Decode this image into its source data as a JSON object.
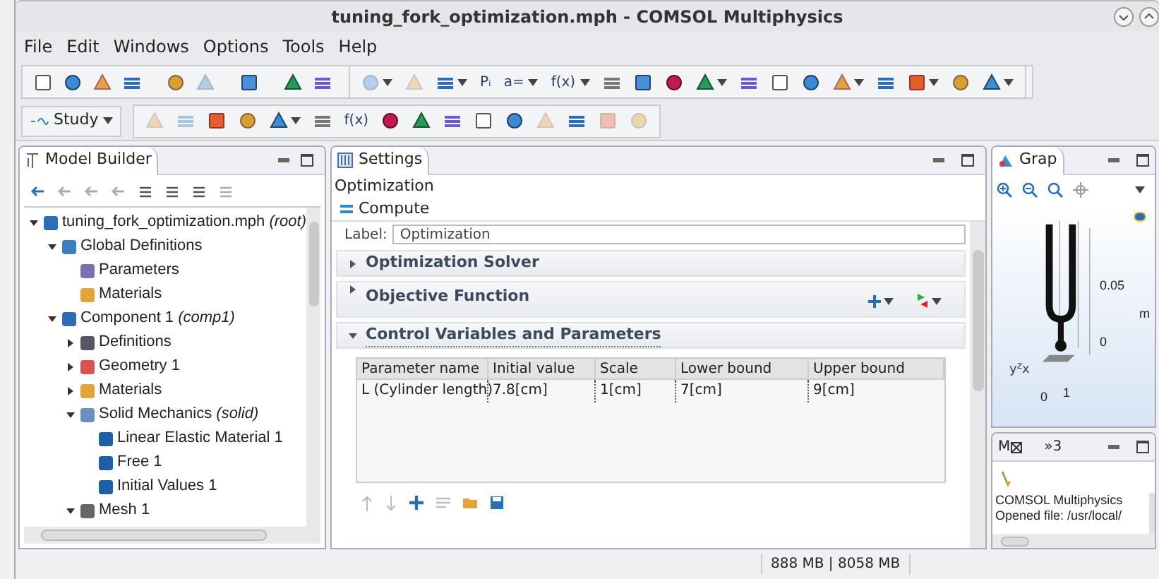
{
  "window": {
    "title": "tuning_fork_optimization.mph - COMSOL Multiphysics"
  },
  "menu": [
    "File",
    "Edit",
    "Windows",
    "Options",
    "Tools",
    "Help"
  ],
  "toolbar_1": [
    {
      "kind": "icon"
    },
    {
      "kind": "icon"
    },
    {
      "kind": "icon"
    },
    {
      "kind": "icon"
    },
    {
      "kind": "sep"
    },
    {
      "kind": "icon"
    },
    {
      "kind": "icon",
      "disabled": true
    },
    {
      "kind": "sep"
    },
    {
      "kind": "icon"
    },
    {
      "kind": "sep"
    },
    {
      "kind": "icon"
    },
    {
      "kind": "icon"
    },
    {
      "kind": "group"
    },
    {
      "kind": "icon",
      "disabled": true,
      "dropdown": true
    },
    {
      "kind": "icon",
      "disabled": true
    },
    {
      "kind": "icon",
      "dropdown": true
    },
    {
      "kind": "text",
      "label": "Pᵢ"
    },
    {
      "kind": "text",
      "label": "a=",
      "dropdown": true
    },
    {
      "kind": "text",
      "label": "f(x)",
      "dropdown": true
    },
    {
      "kind": "icon"
    },
    {
      "kind": "icon"
    },
    {
      "kind": "icon"
    },
    {
      "kind": "icon",
      "dropdown": true
    },
    {
      "kind": "icon"
    },
    {
      "kind": "icon"
    },
    {
      "kind": "icon"
    },
    {
      "kind": "icon",
      "dropdown": true
    },
    {
      "kind": "icon"
    },
    {
      "kind": "icon",
      "dropdown": true
    },
    {
      "kind": "icon"
    },
    {
      "kind": "icon",
      "dropdown": true
    }
  ],
  "toolbar_2": [
    {
      "kind": "study",
      "label": "Study",
      "dropdown": true
    },
    {
      "kind": "group"
    },
    {
      "kind": "icon",
      "disabled": true
    },
    {
      "kind": "icon",
      "disabled": true
    },
    {
      "kind": "icon"
    },
    {
      "kind": "icon"
    },
    {
      "kind": "icon",
      "dropdown": true
    },
    {
      "kind": "icon"
    },
    {
      "kind": "text",
      "label": "f(x)"
    },
    {
      "kind": "icon"
    },
    {
      "kind": "icon"
    },
    {
      "kind": "icon"
    },
    {
      "kind": "icon"
    },
    {
      "kind": "icon"
    },
    {
      "kind": "icon",
      "disabled": true
    },
    {
      "kind": "icon"
    },
    {
      "kind": "icon",
      "disabled": true
    },
    {
      "kind": "icon",
      "disabled": true
    }
  ],
  "model_builder": {
    "title": "Model Builder",
    "tree": [
      {
        "label": "tuning_fork_optimization.mph *(root)*",
        "expanded": true,
        "children": [
          {
            "label": "Global Definitions",
            "expanded": true,
            "children": [
              {
                "label": "Parameters"
              },
              {
                "label": "Materials"
              }
            ]
          },
          {
            "label": "Component 1 *(comp1)*",
            "expanded": true,
            "children": [
              {
                "label": "Definitions",
                "expanded": false
              },
              {
                "label": "Geometry 1",
                "expanded": false
              },
              {
                "label": "Materials",
                "expanded": false
              },
              {
                "label": "Solid Mechanics *(solid)*",
                "expanded": true,
                "children": [
                  {
                    "label": "Linear Elastic Material 1"
                  },
                  {
                    "label": "Free 1"
                  },
                  {
                    "label": "Initial Values 1"
                  }
                ]
              },
              {
                "label": "Mesh 1",
                "expanded": true
              }
            ]
          }
        ]
      }
    ]
  },
  "settings": {
    "title": "Settings",
    "node": "Optimization",
    "compute": "Compute",
    "label_caption": "Label:",
    "label_value": "Optimization",
    "sections": [
      {
        "title": "Optimization Solver",
        "expanded": false
      },
      {
        "title": "Objective Function",
        "expanded": false
      },
      {
        "title": "Control Variables and Parameters",
        "expanded": true
      }
    ],
    "table": {
      "columns": [
        "Parameter name",
        "Initial value",
        "Scale",
        "Lower bound",
        "Upper bound"
      ],
      "rows": [
        [
          "L (Cylinder length)",
          "7.8[cm]",
          "1[cm]",
          "7[cm]",
          "9[cm]"
        ]
      ]
    }
  },
  "graphics": {
    "title": "Grap",
    "tick_labels": [
      "0.05",
      "0"
    ],
    "unit": "m",
    "x_ticks": [
      "0",
      "1"
    ],
    "axis_labels": [
      "y",
      "z",
      "x"
    ]
  },
  "messages": {
    "tab_prefix": "M",
    "tab": "»3",
    "lines": [
      "COMSOL Multiphysics",
      "Opened file: /usr/local/"
    ]
  },
  "status_bar": {
    "memory": "888 MB | 8058 MB"
  }
}
